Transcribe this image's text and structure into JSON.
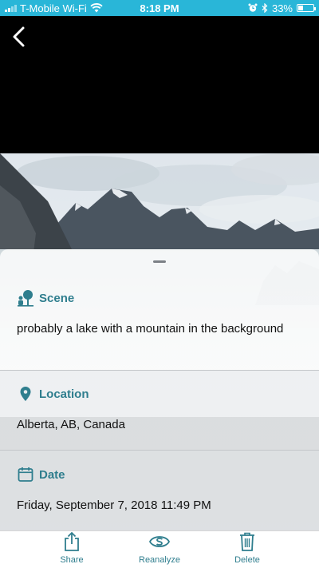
{
  "status_bar": {
    "carrier": "T-Mobile Wi-Fi",
    "time": "8:18 PM",
    "battery_text": "33%",
    "battery_level": 0.33,
    "icons": [
      "signal-bars-icon",
      "wifi-icon",
      "alarm-icon",
      "bluetooth-icon",
      "battery-icon"
    ]
  },
  "navigation": {
    "back_icon": "chevron-left-icon"
  },
  "details": {
    "scene": {
      "icon": "scene-icon",
      "title": "Scene",
      "value": "probably a lake with a mountain in the background"
    },
    "location": {
      "icon": "location-pin-icon",
      "title": "Location",
      "value": "Alberta, AB, Canada"
    },
    "date": {
      "icon": "calendar-icon",
      "title": "Date",
      "value": "Friday, September 7, 2018 11:49 PM"
    }
  },
  "toolbar": {
    "share_label": "Share",
    "reanalyze_label": "Reanalyze",
    "delete_label": "Delete"
  },
  "colors": {
    "accent": "#2f7e8e",
    "status_bar": "#29b6d8"
  }
}
